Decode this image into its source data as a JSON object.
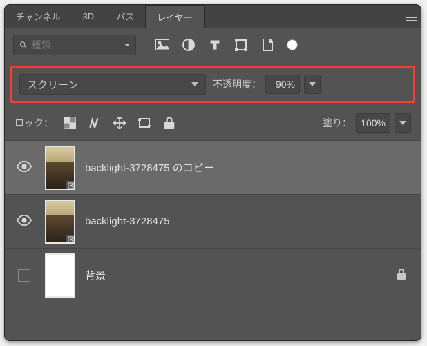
{
  "tabs": {
    "channels": "チャンネル",
    "threeD": "3D",
    "paths": "パス",
    "layers": "レイヤー"
  },
  "filter": {
    "placeholder": "種類"
  },
  "blend": {
    "mode": "スクリーン",
    "opacity_label": "不透明度：",
    "opacity_value": "90%"
  },
  "lock": {
    "label": "ロック：",
    "fill_label": "塗り：",
    "fill_value": "100%"
  },
  "layers": [
    {
      "name": "backlight-3728475 のコピー",
      "visible": true,
      "selected": true,
      "thumb": "photo",
      "locked": false
    },
    {
      "name": "backlight-3728475",
      "visible": true,
      "selected": false,
      "thumb": "photo",
      "locked": false
    },
    {
      "name": "背景",
      "visible": false,
      "selected": false,
      "thumb": "white",
      "locked": true
    }
  ]
}
